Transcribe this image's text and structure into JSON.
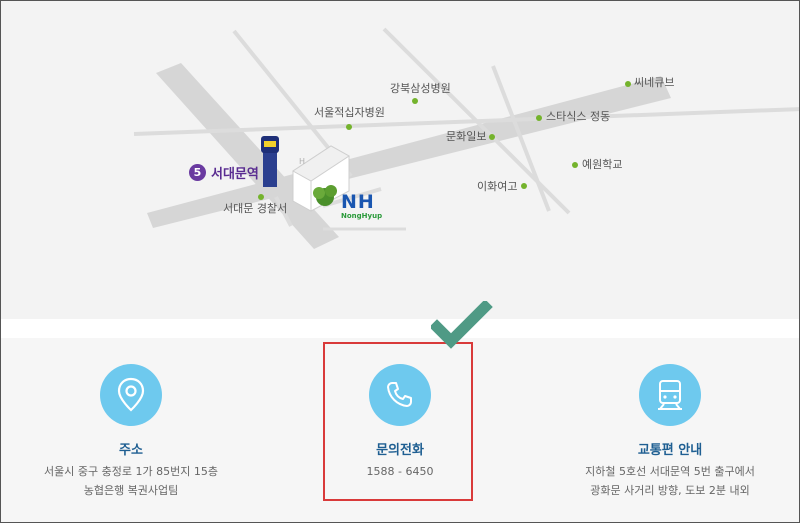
{
  "map": {
    "labels": {
      "hospital_gangbuk": "강북삼성병원",
      "hospital_redcross": "서울적십자병원",
      "munhwa_ilbo": "문화일보",
      "cine_cube": "씨네큐브",
      "state_tower": "스타식스 정동",
      "yewon_school": "예원학교",
      "ewha_girls": "이화여고",
      "police_station": "서대문 경찰서"
    },
    "station": {
      "line_number": "5",
      "name": "서대문역"
    },
    "nh_logo": {
      "main": "NH",
      "sub": "NongHyup"
    }
  },
  "info": {
    "address": {
      "title": "주소",
      "lines": [
        "서울시 중구 충정로 1가 85번지 15층",
        "농협은행 복권사업팀"
      ],
      "icon": "location-pin-icon"
    },
    "phone": {
      "title": "문의전화",
      "lines": [
        "1588 - 6450"
      ],
      "icon": "phone-icon"
    },
    "transport": {
      "title": "교통편 안내",
      "lines": [
        "지하철 5호선 서대문역 5번 출구에서",
        "광화문 사거리 방향, 도보 2분 내외"
      ],
      "icon": "train-icon"
    }
  },
  "colors": {
    "accent_circle": "#6ec9ee",
    "title_blue": "#1f5f92",
    "highlight_red": "#d93a3a",
    "check_green": "#4f9a85"
  }
}
